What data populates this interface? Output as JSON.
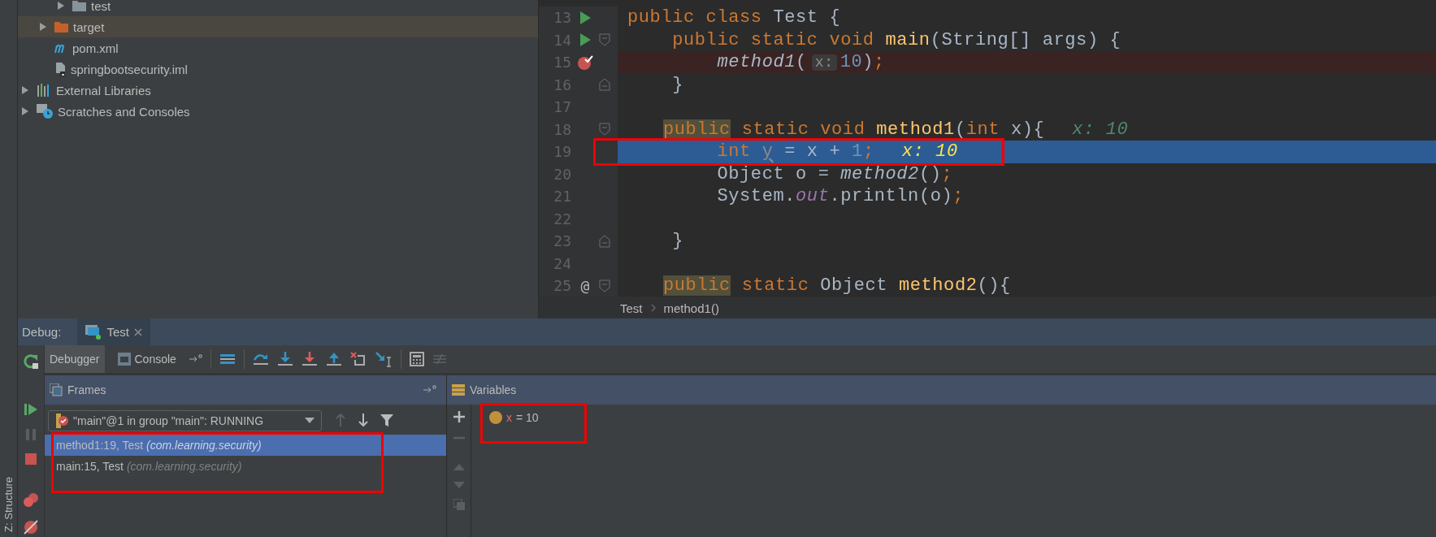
{
  "project_tree": {
    "items": [
      {
        "children": [
          {
            "children": [
              {
                "label": "test",
                "kind": "folder",
                "expanded": false,
                "selected": false
              }
            ]
          },
          {
            "label": "target",
            "kind": "excluded-folder",
            "expanded": false,
            "selected": true
          },
          {
            "label": "pom.xml",
            "kind": "maven",
            "selected": false
          },
          {
            "label": "springbootsecurity.iml",
            "kind": "module-file",
            "selected": false
          }
        ]
      },
      {
        "label": "External Libraries",
        "kind": "libraries",
        "expanded": false,
        "selected": false
      },
      {
        "label": "Scratches and Consoles",
        "kind": "scratches",
        "expanded": false,
        "selected": false
      }
    ]
  },
  "editor": {
    "lines": [
      {
        "number": "13",
        "run": true,
        "tokens": [
          {
            "kind": "kw",
            "text": "public class "
          },
          {
            "kind": "plain",
            "text": "Test {"
          }
        ]
      },
      {
        "number": "14",
        "run": true,
        "fold_start": true,
        "tokens": [
          {
            "kind": "kw",
            "text": "    public static void "
          },
          {
            "kind": "decl",
            "text": "main"
          },
          {
            "kind": "plain",
            "text": "(String[] args) {"
          }
        ]
      },
      {
        "number": "15",
        "breakpoint": true,
        "tokens": [
          {
            "kind": "call",
            "text": "        method1"
          },
          {
            "kind": "plain",
            "text": "("
          },
          {
            "kind": "hint",
            "text": "x:"
          },
          {
            "kind": "num",
            "text": "10"
          },
          {
            "kind": "plain",
            "text": ")"
          },
          {
            "kind": "kw",
            "text": ";"
          }
        ]
      },
      {
        "number": "16",
        "fold_end": true,
        "tokens": [
          {
            "kind": "plain",
            "text": "    }"
          }
        ]
      },
      {
        "number": "17"
      },
      {
        "number": "18",
        "fold_start": true,
        "tokens": [
          {
            "kind": "marked",
            "text": "public"
          },
          {
            "kind": "kw",
            "text": " static void "
          },
          {
            "kind": "decl",
            "text": "method1"
          },
          {
            "kind": "plain",
            "text": "("
          },
          {
            "kind": "kw",
            "text": "int"
          },
          {
            "kind": "plain",
            "text": " x){"
          },
          {
            "kind": "value",
            "text": "x: 10"
          }
        ]
      },
      {
        "number": "19",
        "current": true,
        "tokens": [
          {
            "kind": "kw",
            "text": "        int "
          },
          {
            "kind": "unused",
            "text": "y"
          },
          {
            "kind": "plain",
            "text": " = x + "
          },
          {
            "kind": "num",
            "text": "1"
          },
          {
            "kind": "kw",
            "text": ";"
          },
          {
            "kind": "value",
            "text": "x: 10"
          }
        ]
      },
      {
        "number": "20",
        "tokens": [
          {
            "kind": "plain",
            "text": "        Object o = "
          },
          {
            "kind": "call",
            "text": "method2"
          },
          {
            "kind": "plain",
            "text": "()"
          },
          {
            "kind": "kw",
            "text": ";"
          }
        ]
      },
      {
        "number": "21",
        "tokens": [
          {
            "kind": "plain",
            "text": "        System."
          },
          {
            "kind": "field",
            "text": "out"
          },
          {
            "kind": "plain",
            "text": ".println(o)"
          },
          {
            "kind": "kw",
            "text": ";"
          }
        ]
      },
      {
        "number": "22"
      },
      {
        "number": "23",
        "fold_end": true,
        "tokens": [
          {
            "kind": "plain",
            "text": "    }"
          }
        ]
      },
      {
        "number": "24"
      },
      {
        "number": "25",
        "gutter_text": "@",
        "fold_start": true,
        "tokens": [
          {
            "kind": "marked",
            "text": "public"
          },
          {
            "kind": "kw",
            "text": " static "
          },
          {
            "kind": "plain",
            "text": "Object "
          },
          {
            "kind": "decl",
            "text": "method2"
          },
          {
            "kind": "plain",
            "text": "(){"
          }
        ]
      }
    ],
    "breadcrumbs": [
      "Test",
      "method1()"
    ]
  },
  "debug": {
    "label": "Debug:",
    "tabs": [
      {
        "label": "Test",
        "selected": true
      }
    ],
    "toolbar_tabs": [
      {
        "label": "Debugger",
        "selected": true
      },
      {
        "label": "Console",
        "selected": false
      }
    ],
    "frames": {
      "title": "Frames",
      "thread": "\"main\"@1 in group \"main\": RUNNING",
      "items": [
        {
          "label": "method1:19, Test",
          "package": "(com.learning.security)",
          "selected": true
        },
        {
          "label": "main:15, Test",
          "package": "(com.learning.security)",
          "selected": false
        }
      ]
    },
    "variables": {
      "title": "Variables",
      "items": [
        {
          "name": "x",
          "value": "= 10"
        }
      ]
    }
  },
  "side_strip": {
    "label": "Z: Structure"
  }
}
